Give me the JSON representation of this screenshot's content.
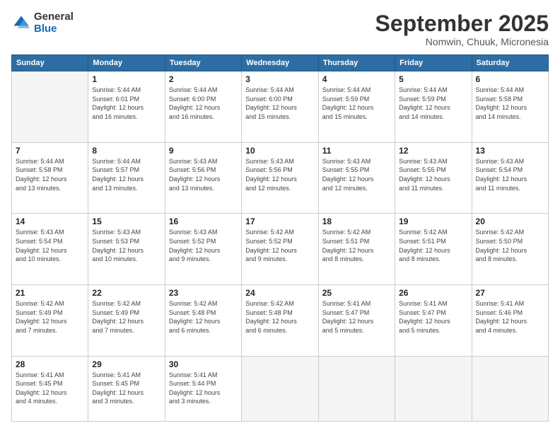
{
  "header": {
    "logo_general": "General",
    "logo_blue": "Blue",
    "month_title": "September 2025",
    "location": "Nomwin, Chuuk, Micronesia"
  },
  "days_of_week": [
    "Sunday",
    "Monday",
    "Tuesday",
    "Wednesday",
    "Thursday",
    "Friday",
    "Saturday"
  ],
  "weeks": [
    [
      {
        "day": null,
        "info": null
      },
      {
        "day": "1",
        "info": "Sunrise: 5:44 AM\nSunset: 6:01 PM\nDaylight: 12 hours\nand 16 minutes."
      },
      {
        "day": "2",
        "info": "Sunrise: 5:44 AM\nSunset: 6:00 PM\nDaylight: 12 hours\nand 16 minutes."
      },
      {
        "day": "3",
        "info": "Sunrise: 5:44 AM\nSunset: 6:00 PM\nDaylight: 12 hours\nand 15 minutes."
      },
      {
        "day": "4",
        "info": "Sunrise: 5:44 AM\nSunset: 5:59 PM\nDaylight: 12 hours\nand 15 minutes."
      },
      {
        "day": "5",
        "info": "Sunrise: 5:44 AM\nSunset: 5:59 PM\nDaylight: 12 hours\nand 14 minutes."
      },
      {
        "day": "6",
        "info": "Sunrise: 5:44 AM\nSunset: 5:58 PM\nDaylight: 12 hours\nand 14 minutes."
      }
    ],
    [
      {
        "day": "7",
        "info": "Sunrise: 5:44 AM\nSunset: 5:58 PM\nDaylight: 12 hours\nand 13 minutes."
      },
      {
        "day": "8",
        "info": "Sunrise: 5:44 AM\nSunset: 5:57 PM\nDaylight: 12 hours\nand 13 minutes."
      },
      {
        "day": "9",
        "info": "Sunrise: 5:43 AM\nSunset: 5:56 PM\nDaylight: 12 hours\nand 13 minutes."
      },
      {
        "day": "10",
        "info": "Sunrise: 5:43 AM\nSunset: 5:56 PM\nDaylight: 12 hours\nand 12 minutes."
      },
      {
        "day": "11",
        "info": "Sunrise: 5:43 AM\nSunset: 5:55 PM\nDaylight: 12 hours\nand 12 minutes."
      },
      {
        "day": "12",
        "info": "Sunrise: 5:43 AM\nSunset: 5:55 PM\nDaylight: 12 hours\nand 11 minutes."
      },
      {
        "day": "13",
        "info": "Sunrise: 5:43 AM\nSunset: 5:54 PM\nDaylight: 12 hours\nand 11 minutes."
      }
    ],
    [
      {
        "day": "14",
        "info": "Sunrise: 5:43 AM\nSunset: 5:54 PM\nDaylight: 12 hours\nand 10 minutes."
      },
      {
        "day": "15",
        "info": "Sunrise: 5:43 AM\nSunset: 5:53 PM\nDaylight: 12 hours\nand 10 minutes."
      },
      {
        "day": "16",
        "info": "Sunrise: 5:43 AM\nSunset: 5:52 PM\nDaylight: 12 hours\nand 9 minutes."
      },
      {
        "day": "17",
        "info": "Sunrise: 5:42 AM\nSunset: 5:52 PM\nDaylight: 12 hours\nand 9 minutes."
      },
      {
        "day": "18",
        "info": "Sunrise: 5:42 AM\nSunset: 5:51 PM\nDaylight: 12 hours\nand 8 minutes."
      },
      {
        "day": "19",
        "info": "Sunrise: 5:42 AM\nSunset: 5:51 PM\nDaylight: 12 hours\nand 8 minutes."
      },
      {
        "day": "20",
        "info": "Sunrise: 5:42 AM\nSunset: 5:50 PM\nDaylight: 12 hours\nand 8 minutes."
      }
    ],
    [
      {
        "day": "21",
        "info": "Sunrise: 5:42 AM\nSunset: 5:49 PM\nDaylight: 12 hours\nand 7 minutes."
      },
      {
        "day": "22",
        "info": "Sunrise: 5:42 AM\nSunset: 5:49 PM\nDaylight: 12 hours\nand 7 minutes."
      },
      {
        "day": "23",
        "info": "Sunrise: 5:42 AM\nSunset: 5:48 PM\nDaylight: 12 hours\nand 6 minutes."
      },
      {
        "day": "24",
        "info": "Sunrise: 5:42 AM\nSunset: 5:48 PM\nDaylight: 12 hours\nand 6 minutes."
      },
      {
        "day": "25",
        "info": "Sunrise: 5:41 AM\nSunset: 5:47 PM\nDaylight: 12 hours\nand 5 minutes."
      },
      {
        "day": "26",
        "info": "Sunrise: 5:41 AM\nSunset: 5:47 PM\nDaylight: 12 hours\nand 5 minutes."
      },
      {
        "day": "27",
        "info": "Sunrise: 5:41 AM\nSunset: 5:46 PM\nDaylight: 12 hours\nand 4 minutes."
      }
    ],
    [
      {
        "day": "28",
        "info": "Sunrise: 5:41 AM\nSunset: 5:45 PM\nDaylight: 12 hours\nand 4 minutes."
      },
      {
        "day": "29",
        "info": "Sunrise: 5:41 AM\nSunset: 5:45 PM\nDaylight: 12 hours\nand 3 minutes."
      },
      {
        "day": "30",
        "info": "Sunrise: 5:41 AM\nSunset: 5:44 PM\nDaylight: 12 hours\nand 3 minutes."
      },
      {
        "day": null,
        "info": null
      },
      {
        "day": null,
        "info": null
      },
      {
        "day": null,
        "info": null
      },
      {
        "day": null,
        "info": null
      }
    ]
  ]
}
